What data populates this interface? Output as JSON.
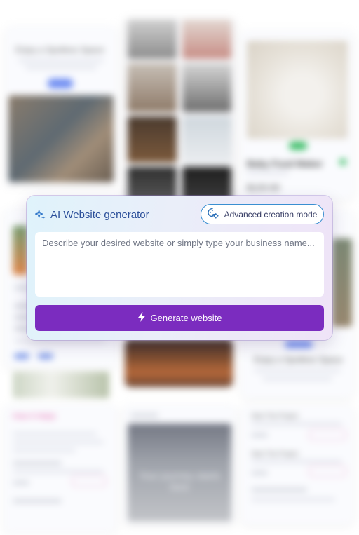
{
  "generator": {
    "title": "AI Website generator",
    "advanced_label": "Advanced creation mode",
    "description_placeholder": "Describe your desired website or simply type your business name...",
    "description_value": "",
    "generate_label": "Generate website"
  },
  "background": {
    "card_space_title": "Enjoy a Spotless Space",
    "product_name": "Baby Food Maker",
    "product_price": "$120.00",
    "card_space_title_2": "Enjoy a Spotless Space",
    "pink_heading": "How it Helps",
    "journey_text": "Your journey starts here",
    "row_label_1": "Start The Project",
    "row_label_2": "Start The Project"
  },
  "colors": {
    "accent": "#7b2cbf",
    "title_blue": "#2b4f9a",
    "border_blue": "#3a8fd1"
  },
  "icons": {
    "title_icon": "sparkle-icon",
    "advanced_icon": "palette-gear-icon",
    "generate_icon": "lightning-icon"
  }
}
